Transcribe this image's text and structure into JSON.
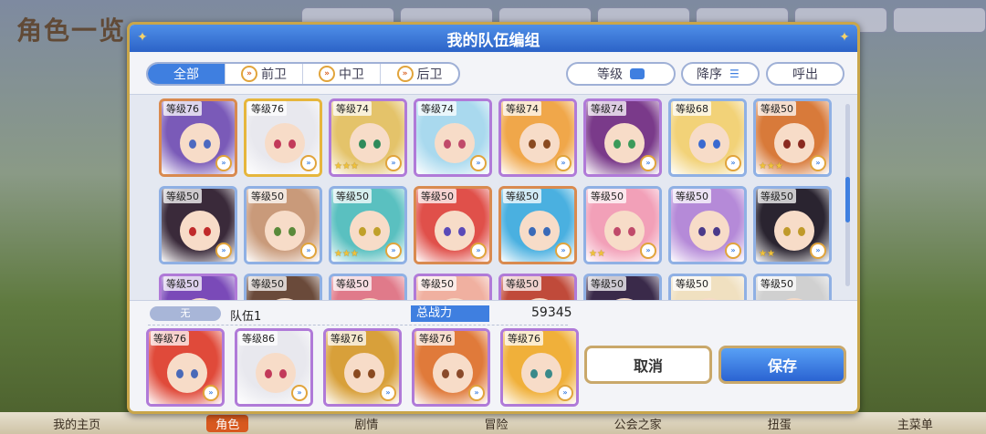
{
  "background": {
    "title": "角色一览",
    "nav": [
      "我的主页",
      "角色",
      "剧情",
      "冒险",
      "公会之家",
      "扭蛋",
      "主菜单"
    ],
    "active_nav": 1
  },
  "dialog": {
    "title": "我的队伍编组",
    "tabs": [
      {
        "label": "全部",
        "active": true,
        "icon": ""
      },
      {
        "label": "前卫",
        "active": false,
        "icon": "chevron-right-icon"
      },
      {
        "label": "中卫",
        "active": false,
        "icon": "chevron-right-icon"
      },
      {
        "label": "后卫",
        "active": false,
        "icon": "chevron-right-icon"
      }
    ],
    "level_label": "等级",
    "sort_label": "降序",
    "call_label": "呼出"
  },
  "grid": [
    {
      "level": "等级76",
      "frame": "copper",
      "hair": "#7a5ab8",
      "eye": "#4d6ac0",
      "stars": ""
    },
    {
      "level": "等级76",
      "frame": "gold",
      "hair": "#e8e8ee",
      "eye": "#c23a5a",
      "stars": ""
    },
    {
      "level": "等级74",
      "frame": "purple",
      "hair": "#e4c36a",
      "eye": "#2f8a5a",
      "stars": "★★★"
    },
    {
      "level": "等级74",
      "frame": "purple",
      "hair": "#a9d9ee",
      "eye": "#c04a6a",
      "stars": ""
    },
    {
      "level": "等级74",
      "frame": "purple",
      "hair": "#f0a74a",
      "eye": "#8a4a20",
      "stars": ""
    },
    {
      "level": "等级74",
      "frame": "purple",
      "hair": "#7a3a8a",
      "eye": "#3c9a5a",
      "stars": ""
    },
    {
      "level": "等级68",
      "frame": "blue",
      "hair": "#f2d278",
      "eye": "#3a6ad0",
      "stars": ""
    },
    {
      "level": "等级50",
      "frame": "blue",
      "hair": "#d87a3a",
      "eye": "#8a2a20",
      "stars": "★★★"
    },
    {
      "level": "等级50",
      "frame": "blue",
      "hair": "#3a2a3a",
      "eye": "#c02a2a",
      "stars": ""
    },
    {
      "level": "等级50",
      "frame": "blue",
      "hair": "#c99a7a",
      "eye": "#5a8a3a",
      "stars": ""
    },
    {
      "level": "等级50",
      "frame": "blue",
      "hair": "#5ac0c0",
      "eye": "#c0a02a",
      "stars": "★★★"
    },
    {
      "level": "等级50",
      "frame": "copper",
      "hair": "#e0504a",
      "eye": "#5a4ab8",
      "stars": ""
    },
    {
      "level": "等级50",
      "frame": "copper",
      "hair": "#4ab0e0",
      "eye": "#3a6ab8",
      "stars": ""
    },
    {
      "level": "等级50",
      "frame": "blue",
      "hair": "#f2a0b8",
      "eye": "#c04a6a",
      "stars": "★★"
    },
    {
      "level": "等级50",
      "frame": "blue",
      "hair": "#b58ad8",
      "eye": "#4a3a8a",
      "stars": ""
    },
    {
      "level": "等级50",
      "frame": "blue",
      "hair": "#2a2430",
      "eye": "#c09a2a",
      "stars": "★★"
    },
    {
      "level": "等级50",
      "frame": "purple",
      "hair": "#7a4ab8",
      "eye": "#4a4a8a",
      "stars": ""
    },
    {
      "level": "等级50",
      "frame": "blue",
      "hair": "#6a4a3a",
      "eye": "#5a3a2a",
      "stars": ""
    },
    {
      "level": "等级50",
      "frame": "blue",
      "hair": "#e07a8a",
      "eye": "#5a3a8a",
      "stars": ""
    },
    {
      "level": "等级50",
      "frame": "purple",
      "hair": "#f0b0a0",
      "eye": "#8a4a4a",
      "stars": ""
    },
    {
      "level": "等级50",
      "frame": "purple",
      "hair": "#c04a3a",
      "eye": "#3a3a3a",
      "stars": ""
    },
    {
      "level": "等级50",
      "frame": "blue",
      "hair": "#3a2a4a",
      "eye": "#8a6a2a",
      "stars": ""
    },
    {
      "level": "等级50",
      "frame": "blue",
      "hair": "#f0e0c0",
      "eye": "#7a7a7a",
      "stars": ""
    },
    {
      "level": "等级50",
      "frame": "blue",
      "hair": "#d0d0d0",
      "eye": "#5a5a8a",
      "stars": ""
    }
  ],
  "team": {
    "slot_label": "无",
    "name": "队伍1",
    "power_label": "总战力",
    "power_value": "59345",
    "members": [
      {
        "level": "等级76",
        "frame": "purple",
        "hair": "#e04a3a",
        "eye": "#4a6ab8",
        "stars": ""
      },
      {
        "level": "等级86",
        "frame": "purple",
        "hair": "#e8e8ee",
        "eye": "#c23a5a",
        "stars": ""
      },
      {
        "level": "等级76",
        "frame": "purple",
        "hair": "#d8a03a",
        "eye": "#8a4a20",
        "stars": ""
      },
      {
        "level": "等级76",
        "frame": "purple",
        "hair": "#e07a3a",
        "eye": "#8a4a2a",
        "stars": ""
      },
      {
        "level": "等级76",
        "frame": "purple",
        "hair": "#f0b03a",
        "eye": "#3a8a8a",
        "stars": ""
      }
    ]
  },
  "buttons": {
    "cancel": "取消",
    "save": "保存"
  }
}
